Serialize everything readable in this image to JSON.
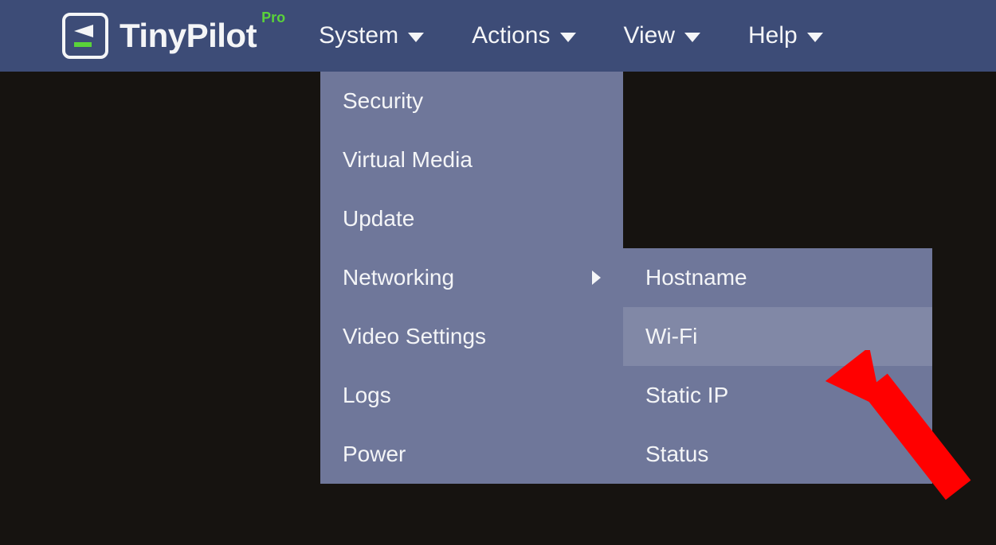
{
  "brand": {
    "name": "TinyPilot",
    "badge": "Pro"
  },
  "nav": {
    "items": [
      {
        "label": "System"
      },
      {
        "label": "Actions"
      },
      {
        "label": "View"
      },
      {
        "label": "Help"
      }
    ]
  },
  "system_menu": {
    "items": [
      {
        "label": "Security"
      },
      {
        "label": "Virtual Media"
      },
      {
        "label": "Update"
      },
      {
        "label": "Networking",
        "has_submenu": true
      },
      {
        "label": "Video Settings"
      },
      {
        "label": "Logs"
      },
      {
        "label": "Power"
      }
    ]
  },
  "networking_submenu": {
    "items": [
      {
        "label": "Hostname"
      },
      {
        "label": "Wi-Fi",
        "hovered": true
      },
      {
        "label": "Static IP"
      },
      {
        "label": "Status"
      }
    ]
  },
  "colors": {
    "topbar": "#3d4c77",
    "dropdown": "#6f779a",
    "hover": "#8188a6",
    "accent": "#5ad33a",
    "bg": "#161310",
    "annotation": "#ff0000"
  }
}
